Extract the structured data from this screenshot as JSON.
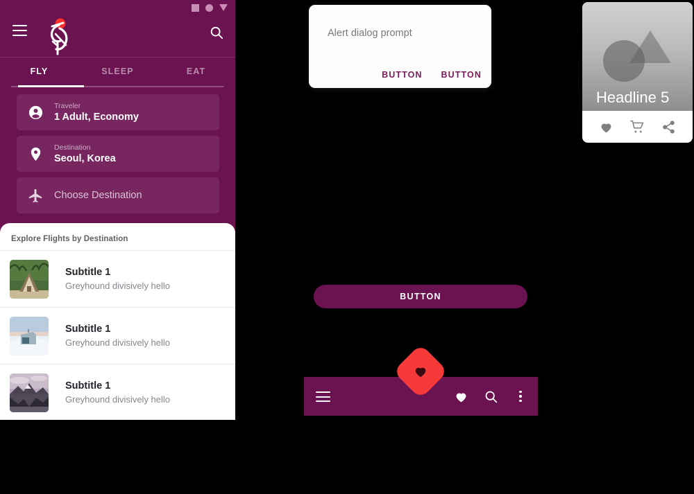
{
  "phone": {
    "statusbar": {
      "icons": [
        "square-icon",
        "circle-icon",
        "triangle-down-icon"
      ]
    },
    "appbar": {
      "menu_icon": "hamburger-menu-icon",
      "logo_icon": "stork-logo-icon",
      "search_icon": "search-icon"
    },
    "tabs": [
      {
        "label": "FLY",
        "active": true
      },
      {
        "label": "SLEEP",
        "active": false
      },
      {
        "label": "EAT",
        "active": false
      }
    ],
    "fields": [
      {
        "icon": "person-icon",
        "label": "Traveler",
        "value": "1 Adult, Economy",
        "is_placeholder": false
      },
      {
        "icon": "location-pin-icon",
        "label": "Destination",
        "value": "Seoul, Korea",
        "is_placeholder": false
      },
      {
        "icon": "airplane-icon",
        "label": "",
        "value": "Choose Destination",
        "is_placeholder": true
      }
    ],
    "sheet": {
      "title": "Explore Flights by Destination",
      "items": [
        {
          "thumb": "a-frame-hut-thumbnail",
          "title": "Subtitle 1",
          "subtitle": "Greyhound divisively hello"
        },
        {
          "thumb": "snow-cabin-thumbnail",
          "title": "Subtitle 1",
          "subtitle": "Greyhound divisively hello"
        },
        {
          "thumb": "mountain-lake-thumbnail",
          "title": "Subtitle 1",
          "subtitle": "Greyhound divisively hello"
        }
      ]
    }
  },
  "dialog": {
    "prompt": "Alert dialog prompt",
    "buttons": [
      {
        "label": "BUTTON"
      },
      {
        "label": "BUTTON"
      }
    ]
  },
  "card": {
    "headline": "Headline 5",
    "media_placeholder": "circle-and-triangle-placeholder-icon",
    "actions": [
      {
        "icon": "heart-icon"
      },
      {
        "icon": "shopping-cart-icon"
      },
      {
        "icon": "share-icon"
      }
    ]
  },
  "pill_button": {
    "label": "BUTTON"
  },
  "bottom_bar": {
    "menu_icon": "hamburger-menu-icon",
    "actions": [
      {
        "icon": "heart-icon"
      },
      {
        "icon": "search-icon"
      },
      {
        "icon": "more-vertical-icon"
      }
    ],
    "fab": {
      "icon": "heart-icon",
      "shape": "diamond"
    }
  },
  "colors": {
    "primary": "#6b1250",
    "primary_text": "#7b1a5c",
    "accent": "#f63a3a",
    "surface": "#ffffff",
    "background": "#000000"
  }
}
